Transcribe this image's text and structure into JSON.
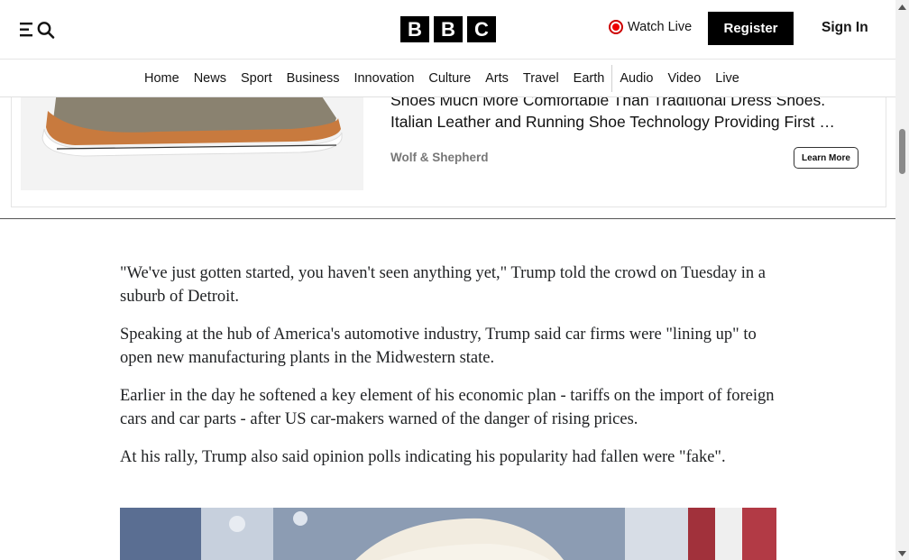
{
  "header": {
    "logo_letters": [
      "B",
      "B",
      "C"
    ],
    "watch_live": "Watch Live",
    "register": "Register",
    "sign_in": "Sign In"
  },
  "nav": {
    "items": [
      "Home",
      "News",
      "Sport",
      "Business",
      "Innovation",
      "Culture",
      "Arts",
      "Travel",
      "Earth",
      "Audio",
      "Video",
      "Live"
    ]
  },
  "ad": {
    "line1": "Shoes Much More Comfortable Than Traditional Dress Shoes.",
    "line2": "Italian Leather and Running Shoe Technology Providing First …",
    "brand": "Wolf & Shepherd",
    "cta": "Learn More"
  },
  "article": {
    "paragraphs": [
      "\"We've just gotten started, you haven't seen anything yet,\" Trump told the crowd on Tuesday in a suburb of Detroit.",
      "Speaking at the hub of America's automotive industry, Trump said car firms were \"lining up\" to open new manufacturing plants in the Midwestern state.",
      "Earlier in the day he softened a key element of his economic plan - tariffs on the import of foreign cars and car parts - after US car-makers warned of the danger of rising prices.",
      "At his rally, Trump also said opinion polls indicating his popularity had fallen were \"fake\"."
    ]
  },
  "icons": {
    "menu": "menu-icon",
    "search": "search-icon",
    "live": "live-dot-icon"
  },
  "colors": {
    "brand_black": "#000000",
    "live_red": "#e00000"
  }
}
